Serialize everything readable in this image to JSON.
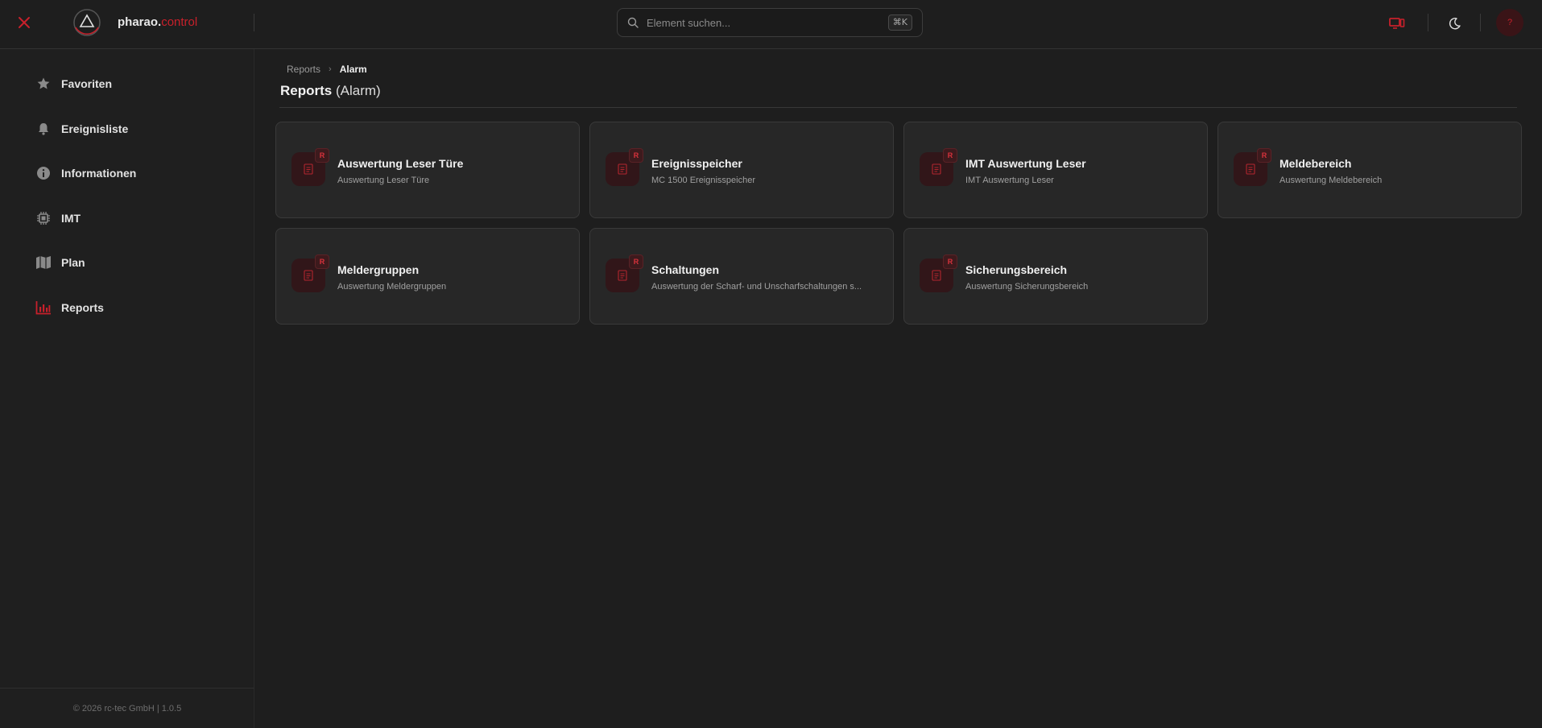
{
  "header": {
    "brand_name": "pharao.",
    "brand_accent": "control",
    "search_placeholder": "Element suchen...",
    "search_shortcut": "⌘K",
    "help_label": "?",
    "accent_color": "#c8202b",
    "icons": [
      "close-icon",
      "logo-triangle-icon",
      "search-icon",
      "monitor-icon",
      "moon-icon"
    ]
  },
  "sidebar": {
    "items": [
      {
        "label": "Favoriten",
        "icon": "star-icon"
      },
      {
        "label": "Ereignisliste",
        "icon": "bell-icon"
      },
      {
        "label": "Informationen",
        "icon": "info-icon"
      },
      {
        "label": "IMT",
        "icon": "chip-icon"
      },
      {
        "label": "Plan",
        "icon": "map-icon"
      },
      {
        "label": "Reports",
        "icon": "bar-chart-icon",
        "active": true
      }
    ],
    "footer": "© 2026 rc-tec GmbH | 1.0.5"
  },
  "main": {
    "breadcrumb": [
      "Reports",
      "Alarm"
    ],
    "title": "Reports",
    "title_sub": "(Alarm)",
    "cards": [
      {
        "title": "Auswertung Leser Türe",
        "subtitle": "Auswertung Leser Türe",
        "badge": "R"
      },
      {
        "title": "Ereignisspeicher",
        "subtitle": "MC 1500 Ereignisspeicher",
        "badge": "R"
      },
      {
        "title": "IMT Auswertung Leser",
        "subtitle": "IMT Auswertung Leser",
        "badge": "R"
      },
      {
        "title": "Meldebereich",
        "subtitle": "Auswertung Meldebereich",
        "badge": "R"
      },
      {
        "title": "Meldergruppen",
        "subtitle": "Auswertung Meldergruppen",
        "badge": "R"
      },
      {
        "title": "Schaltungen",
        "subtitle": "Auswertung der Scharf- und Unscharfschaltungen s...",
        "badge": "R"
      },
      {
        "title": "Sicherungsbereich",
        "subtitle": "Auswertung Sicherungsbereich",
        "badge": "R"
      }
    ]
  }
}
